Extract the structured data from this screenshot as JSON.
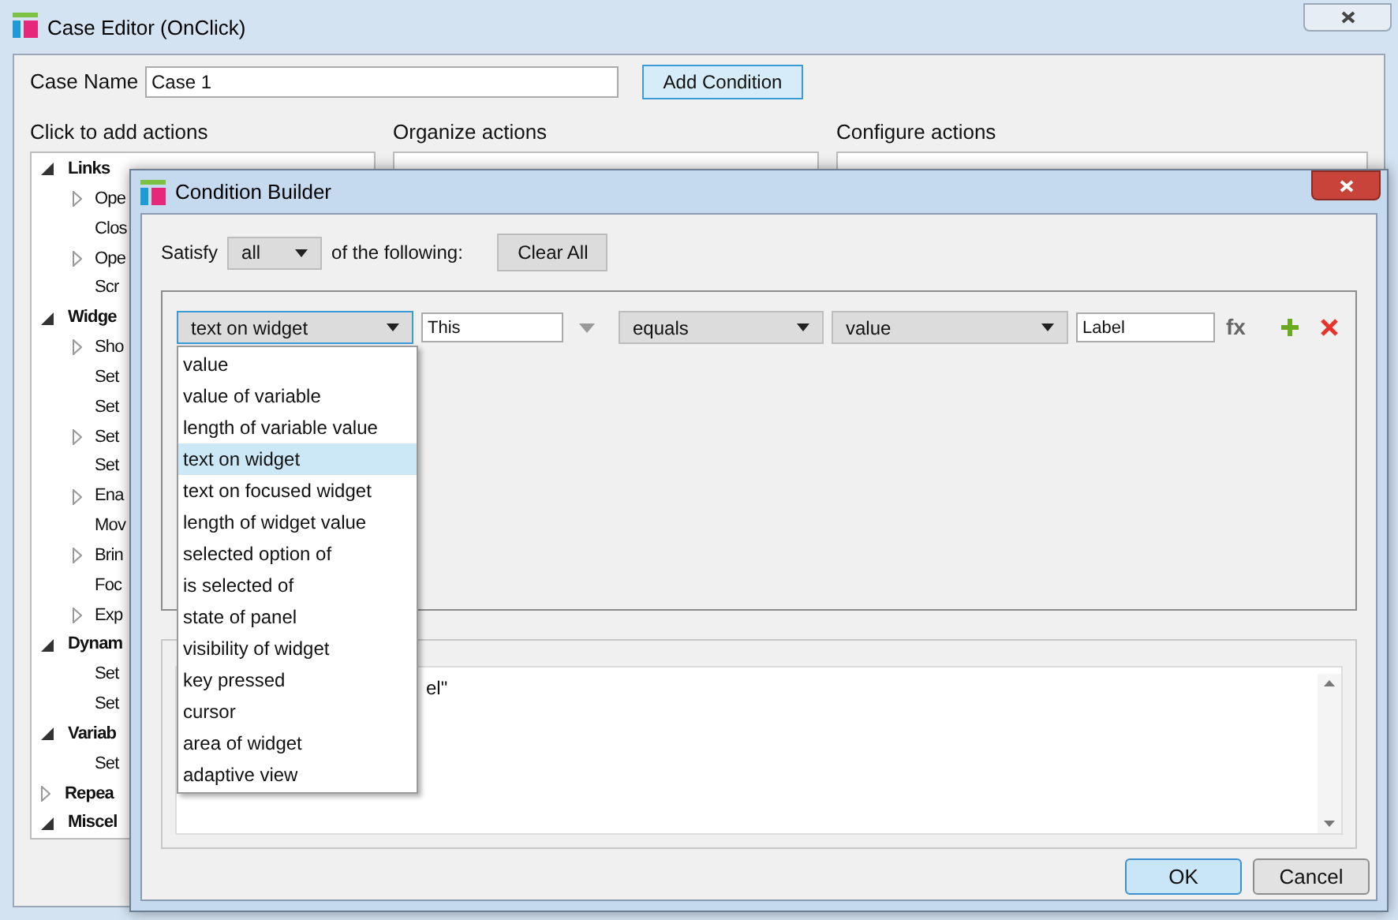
{
  "case_editor": {
    "title": "Case Editor (OnClick)",
    "case_name_label": "Case Name",
    "case_name_value": "Case 1",
    "add_condition_button": "Add Condition",
    "sections": [
      "Click to add actions",
      "Organize actions",
      "Configure actions"
    ],
    "action_tree": [
      {
        "label": "Links",
        "expanded": true,
        "children": [
          {
            "label": "Ope",
            "kind": "expandable"
          },
          {
            "label": "Clos",
            "kind": "leaf"
          },
          {
            "label": "Ope",
            "kind": "expandable"
          },
          {
            "label": "Scr",
            "kind": "leaf"
          }
        ]
      },
      {
        "label": "Widge",
        "expanded": true,
        "children": [
          {
            "label": "Sho",
            "kind": "expandable"
          },
          {
            "label": "Set",
            "kind": "leaf"
          },
          {
            "label": "Set",
            "kind": "leaf"
          },
          {
            "label": "Set",
            "kind": "expandable"
          },
          {
            "label": "Set",
            "kind": "leaf"
          },
          {
            "label": "Ena",
            "kind": "expandable"
          },
          {
            "label": "Mov",
            "kind": "leaf"
          },
          {
            "label": "Brin",
            "kind": "expandable"
          },
          {
            "label": "Foc",
            "kind": "leaf"
          },
          {
            "label": "Exp",
            "kind": "expandable"
          }
        ]
      },
      {
        "label": "Dynam",
        "expanded": true,
        "children": [
          {
            "label": "Set",
            "kind": "leaf"
          },
          {
            "label": "Set",
            "kind": "leaf"
          }
        ]
      },
      {
        "label": "Variab",
        "expanded": true,
        "children": [
          {
            "label": "Set",
            "kind": "leaf"
          }
        ]
      },
      {
        "label": "Repea",
        "expanded": false
      },
      {
        "label": "Miscel",
        "expanded": true
      }
    ]
  },
  "condition_builder": {
    "title": "Condition Builder",
    "satisfy_label": "Satisfy",
    "satisfy_value": "all",
    "following_label": "of the following:",
    "clear_all_button": "Clear All",
    "condition": {
      "subject": "text on widget",
      "target": "This",
      "operator": "equals",
      "value_type": "value",
      "value": "Label",
      "fx_button": "fx"
    },
    "subject_options": [
      {
        "label": "value",
        "selected": false
      },
      {
        "label": "value of variable",
        "selected": false
      },
      {
        "label": "length of variable value",
        "selected": false
      },
      {
        "label": "text on widget",
        "selected": true
      },
      {
        "label": "text on focused widget",
        "selected": false
      },
      {
        "label": "length of widget value",
        "selected": false
      },
      {
        "label": "selected option of",
        "selected": false
      },
      {
        "label": "is selected of",
        "selected": false
      },
      {
        "label": "state of panel",
        "selected": false
      },
      {
        "label": "visibility of widget",
        "selected": false
      },
      {
        "label": "key pressed",
        "selected": false
      },
      {
        "label": "cursor",
        "selected": false
      },
      {
        "label": "area of widget",
        "selected": false
      },
      {
        "label": "adaptive view",
        "selected": false
      }
    ],
    "description_text": "el\"",
    "buttons": [
      {
        "label": "OK",
        "default": true
      },
      {
        "label": "Cancel",
        "default": false
      }
    ]
  }
}
